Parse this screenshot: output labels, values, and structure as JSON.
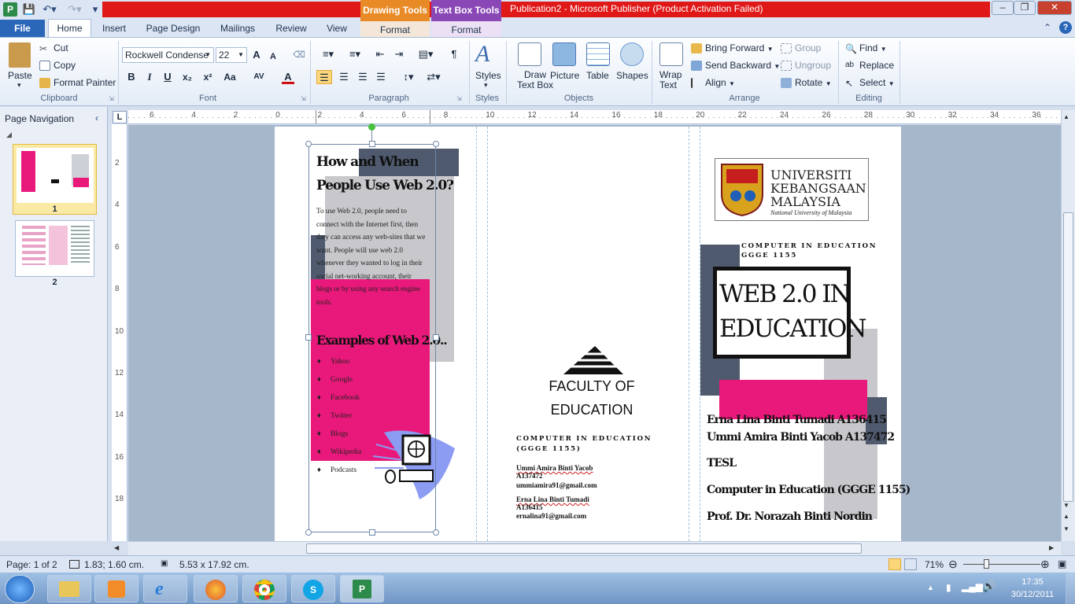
{
  "app": {
    "title": "Publication2  -  Microsoft Publisher (Product Activation Failed)",
    "app_icon": "P",
    "context_tabs": [
      "Drawing Tools",
      "Text Box Tools"
    ]
  },
  "tabs": {
    "file": "File",
    "items": [
      "Home",
      "Insert",
      "Page Design",
      "Mailings",
      "Review",
      "View"
    ],
    "context_format_1": "Format",
    "context_format_2": "Format"
  },
  "ribbon": {
    "clipboard": {
      "paste": "Paste",
      "cut": "Cut",
      "copy": "Copy",
      "format_painter": "Format Painter",
      "label": "Clipboard"
    },
    "font": {
      "name": "Rockwell Condense",
      "size": "22",
      "label": "Font",
      "grow": "A",
      "shrink": "A",
      "bold": "B",
      "italic": "I",
      "underline": "U",
      "subscript": "x₂",
      "superscript": "x²",
      "change_case": "Aa",
      "spacing": "AV",
      "color": "A"
    },
    "paragraph": {
      "label": "Paragraph",
      "pilcrow": "¶"
    },
    "styles": {
      "styles": "Styles",
      "label": "Styles"
    },
    "objects": {
      "draw_text_box_1": "Draw",
      "draw_text_box_2": "Text Box",
      "picture": "Picture",
      "table": "Table",
      "shapes": "Shapes",
      "label": "Objects"
    },
    "arrange": {
      "wrap_1": "Wrap",
      "wrap_2": "Text",
      "bring_forward": "Bring Forward",
      "send_backward": "Send Backward",
      "align": "Align",
      "group": "Group",
      "ungroup": "Ungroup",
      "rotate": "Rotate",
      "label": "Arrange"
    },
    "editing": {
      "find": "Find",
      "replace": "Replace",
      "select": "Select",
      "label": "Editing"
    }
  },
  "nav": {
    "title": "Page Navigation",
    "pages": [
      "1",
      "2"
    ]
  },
  "ruler": {
    "h_ticks": [
      "6",
      "4",
      "2",
      "0",
      "2",
      "4",
      "6",
      "8",
      "10",
      "12",
      "14",
      "16",
      "18",
      "20",
      "22",
      "24",
      "26",
      "28",
      "30",
      "32",
      "34",
      "36"
    ],
    "v_ticks": [
      "2",
      "4",
      "6",
      "8",
      "10",
      "12",
      "14",
      "16",
      "18"
    ],
    "corner": "L"
  },
  "brochure": {
    "left": {
      "heading_1": "How and When",
      "heading_2": "People Use Web 2.0?",
      "body": "To use Web 2.0, people need to connect with the Internet first, then they can access any web-sites that we want. People will use web 2.0 whenever they wanted to log in their social net-working account, their blogs or by using any search engine tools.",
      "examples_heading": "Examples of Web 2.0..",
      "bullet_glyph": "♦",
      "examples": [
        "Yahoo",
        "Google",
        "Facebook",
        "Twitter",
        "Blogs",
        "Wikipedia",
        "Podcasts"
      ]
    },
    "middle": {
      "faculty_1": "FACULTY OF",
      "faculty_2": "EDUCATION",
      "course_1": "COMPUTER IN EDUCATION",
      "course_2": "(GGGE 1155)",
      "member1_name": "Ummi Amira Binti Yacob",
      "member1_id": "A137472",
      "member1_email": "ummiamira91@gmail.com",
      "member2_name": "Erna Lina Binti Tumadi",
      "member2_id": "A136415",
      "member2_email": "ernalina91@gmail.com"
    },
    "right": {
      "uni_1": "UNIVERSITI",
      "uni_2": "KEBANGSAAN",
      "uni_3": "MALAYSIA",
      "uni_tag": "National University of Malaysia",
      "course_1": "COMPUTER IN EDUCATION",
      "course_2": "GGGE 1155",
      "title_1": "WEB 2.0 IN",
      "title_2": "EDUCATION",
      "line1": "Erna Lina Binti Tumadi  A136415",
      "line2": "Ummi Amira Binti Yacob A137472",
      "line3": "TESL",
      "line4": "Computer in Education (GGGE 1155)",
      "line5": "Prof. Dr. Norazah Binti Nordin"
    }
  },
  "status": {
    "page": "Page: 1 of 2",
    "position": "1.83; 1.60 cm.",
    "size": "5.53 x 17.92 cm.",
    "zoom": "71%"
  },
  "taskbar": {
    "time": "17:35",
    "date": "30/12/2011"
  },
  "colors": {
    "accent_pink": "#e8197a",
    "slate": "#4f5a6e",
    "gray_block": "#c8c8cc",
    "title_red": "#e01818"
  }
}
